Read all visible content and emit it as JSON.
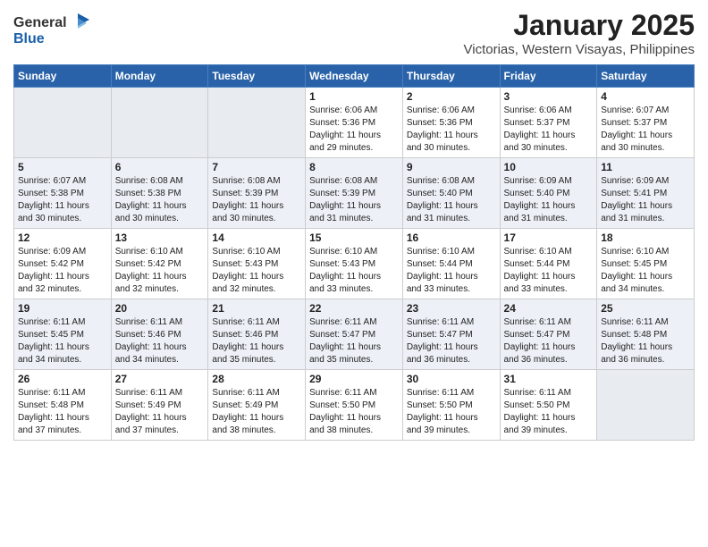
{
  "header": {
    "logo_line1": "General",
    "logo_line2": "Blue",
    "title": "January 2025",
    "subtitle": "Victorias, Western Visayas, Philippines"
  },
  "weekdays": [
    "Sunday",
    "Monday",
    "Tuesday",
    "Wednesday",
    "Thursday",
    "Friday",
    "Saturday"
  ],
  "weeks": [
    {
      "days": [
        {
          "num": "",
          "info": ""
        },
        {
          "num": "",
          "info": ""
        },
        {
          "num": "",
          "info": ""
        },
        {
          "num": "1",
          "info": "Sunrise: 6:06 AM\nSunset: 5:36 PM\nDaylight: 11 hours\nand 29 minutes."
        },
        {
          "num": "2",
          "info": "Sunrise: 6:06 AM\nSunset: 5:36 PM\nDaylight: 11 hours\nand 30 minutes."
        },
        {
          "num": "3",
          "info": "Sunrise: 6:06 AM\nSunset: 5:37 PM\nDaylight: 11 hours\nand 30 minutes."
        },
        {
          "num": "4",
          "info": "Sunrise: 6:07 AM\nSunset: 5:37 PM\nDaylight: 11 hours\nand 30 minutes."
        }
      ]
    },
    {
      "days": [
        {
          "num": "5",
          "info": "Sunrise: 6:07 AM\nSunset: 5:38 PM\nDaylight: 11 hours\nand 30 minutes."
        },
        {
          "num": "6",
          "info": "Sunrise: 6:08 AM\nSunset: 5:38 PM\nDaylight: 11 hours\nand 30 minutes."
        },
        {
          "num": "7",
          "info": "Sunrise: 6:08 AM\nSunset: 5:39 PM\nDaylight: 11 hours\nand 30 minutes."
        },
        {
          "num": "8",
          "info": "Sunrise: 6:08 AM\nSunset: 5:39 PM\nDaylight: 11 hours\nand 31 minutes."
        },
        {
          "num": "9",
          "info": "Sunrise: 6:08 AM\nSunset: 5:40 PM\nDaylight: 11 hours\nand 31 minutes."
        },
        {
          "num": "10",
          "info": "Sunrise: 6:09 AM\nSunset: 5:40 PM\nDaylight: 11 hours\nand 31 minutes."
        },
        {
          "num": "11",
          "info": "Sunrise: 6:09 AM\nSunset: 5:41 PM\nDaylight: 11 hours\nand 31 minutes."
        }
      ]
    },
    {
      "days": [
        {
          "num": "12",
          "info": "Sunrise: 6:09 AM\nSunset: 5:42 PM\nDaylight: 11 hours\nand 32 minutes."
        },
        {
          "num": "13",
          "info": "Sunrise: 6:10 AM\nSunset: 5:42 PM\nDaylight: 11 hours\nand 32 minutes."
        },
        {
          "num": "14",
          "info": "Sunrise: 6:10 AM\nSunset: 5:43 PM\nDaylight: 11 hours\nand 32 minutes."
        },
        {
          "num": "15",
          "info": "Sunrise: 6:10 AM\nSunset: 5:43 PM\nDaylight: 11 hours\nand 33 minutes."
        },
        {
          "num": "16",
          "info": "Sunrise: 6:10 AM\nSunset: 5:44 PM\nDaylight: 11 hours\nand 33 minutes."
        },
        {
          "num": "17",
          "info": "Sunrise: 6:10 AM\nSunset: 5:44 PM\nDaylight: 11 hours\nand 33 minutes."
        },
        {
          "num": "18",
          "info": "Sunrise: 6:10 AM\nSunset: 5:45 PM\nDaylight: 11 hours\nand 34 minutes."
        }
      ]
    },
    {
      "days": [
        {
          "num": "19",
          "info": "Sunrise: 6:11 AM\nSunset: 5:45 PM\nDaylight: 11 hours\nand 34 minutes."
        },
        {
          "num": "20",
          "info": "Sunrise: 6:11 AM\nSunset: 5:46 PM\nDaylight: 11 hours\nand 34 minutes."
        },
        {
          "num": "21",
          "info": "Sunrise: 6:11 AM\nSunset: 5:46 PM\nDaylight: 11 hours\nand 35 minutes."
        },
        {
          "num": "22",
          "info": "Sunrise: 6:11 AM\nSunset: 5:47 PM\nDaylight: 11 hours\nand 35 minutes."
        },
        {
          "num": "23",
          "info": "Sunrise: 6:11 AM\nSunset: 5:47 PM\nDaylight: 11 hours\nand 36 minutes."
        },
        {
          "num": "24",
          "info": "Sunrise: 6:11 AM\nSunset: 5:47 PM\nDaylight: 11 hours\nand 36 minutes."
        },
        {
          "num": "25",
          "info": "Sunrise: 6:11 AM\nSunset: 5:48 PM\nDaylight: 11 hours\nand 36 minutes."
        }
      ]
    },
    {
      "days": [
        {
          "num": "26",
          "info": "Sunrise: 6:11 AM\nSunset: 5:48 PM\nDaylight: 11 hours\nand 37 minutes."
        },
        {
          "num": "27",
          "info": "Sunrise: 6:11 AM\nSunset: 5:49 PM\nDaylight: 11 hours\nand 37 minutes."
        },
        {
          "num": "28",
          "info": "Sunrise: 6:11 AM\nSunset: 5:49 PM\nDaylight: 11 hours\nand 38 minutes."
        },
        {
          "num": "29",
          "info": "Sunrise: 6:11 AM\nSunset: 5:50 PM\nDaylight: 11 hours\nand 38 minutes."
        },
        {
          "num": "30",
          "info": "Sunrise: 6:11 AM\nSunset: 5:50 PM\nDaylight: 11 hours\nand 39 minutes."
        },
        {
          "num": "31",
          "info": "Sunrise: 6:11 AM\nSunset: 5:50 PM\nDaylight: 11 hours\nand 39 minutes."
        },
        {
          "num": "",
          "info": ""
        }
      ]
    }
  ]
}
